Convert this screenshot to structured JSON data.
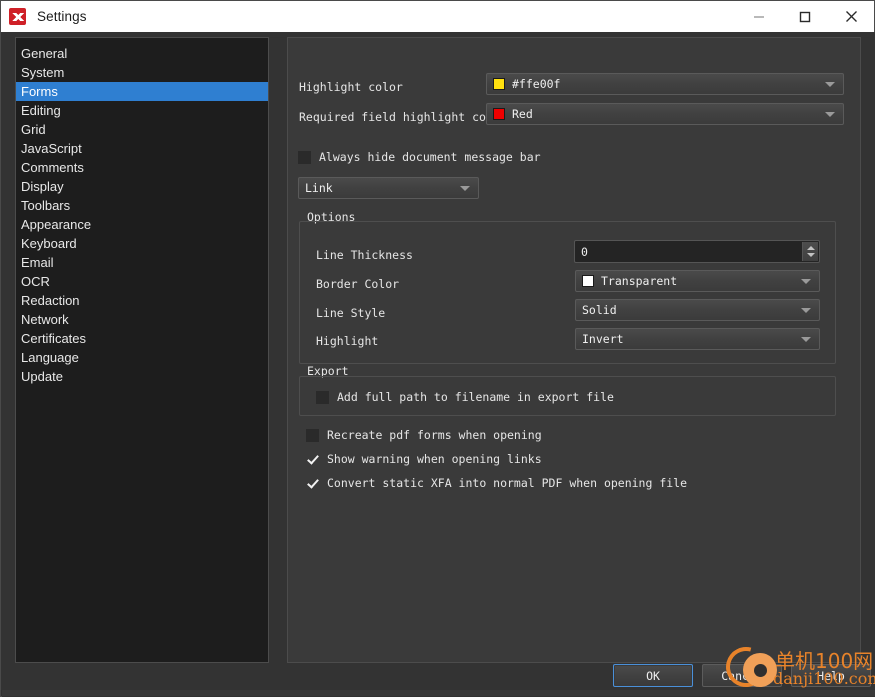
{
  "window": {
    "title": "Settings",
    "icon": "app-logo-icon",
    "controls": {
      "minimize": "minimize-icon",
      "maximize": "maximize-icon",
      "close": "close-icon"
    }
  },
  "sidebar": {
    "selected": "Forms",
    "items": [
      {
        "label": "General"
      },
      {
        "label": "System"
      },
      {
        "label": "Forms"
      },
      {
        "label": "Editing"
      },
      {
        "label": "Grid"
      },
      {
        "label": "JavaScript"
      },
      {
        "label": "Comments"
      },
      {
        "label": "Display"
      },
      {
        "label": "Toolbars"
      },
      {
        "label": "Appearance"
      },
      {
        "label": "Keyboard"
      },
      {
        "label": "Email"
      },
      {
        "label": "OCR"
      },
      {
        "label": "Redaction"
      },
      {
        "label": "Network"
      },
      {
        "label": "Certificates"
      },
      {
        "label": "Language"
      },
      {
        "label": "Update"
      }
    ]
  },
  "panel": {
    "highlight_color": {
      "label": "Highlight color",
      "value": "#ffe00f",
      "swatch": "#ffe00f"
    },
    "required_field_highlight_color": {
      "label": "Required field highlight color",
      "value": "Red",
      "swatch": "#ef0000"
    },
    "always_hide_message_bar": {
      "label": "Always hide document message bar",
      "checked": false
    },
    "field_type": {
      "value": "Link"
    },
    "options_group": {
      "title": "Options",
      "rows": [
        {
          "label": "Line Thickness",
          "value": "0",
          "control": "spinbox"
        },
        {
          "label": "Border Color",
          "value": "Transparent",
          "control": "combo",
          "swatch": "#ffffff"
        },
        {
          "label": "Line Style",
          "value": "Solid",
          "control": "combo"
        },
        {
          "label": "Highlight",
          "value": "Invert",
          "control": "combo"
        }
      ]
    },
    "export_group": {
      "title": "Export",
      "checkbox": {
        "label": "Add full path to filename in export file",
        "checked": false
      }
    },
    "bottom_checkboxes": [
      {
        "label": "Recreate pdf forms when opening",
        "checked": false
      },
      {
        "label": "Show warning when opening links",
        "checked": true
      },
      {
        "label": "Convert static XFA into normal PDF when opening file",
        "checked": true
      }
    ]
  },
  "footer": {
    "ok": "OK",
    "cancel": "Cancel",
    "help": "Help"
  },
  "watermark": {
    "cn": "单机100网",
    "en": "danji100.com"
  },
  "colors": {
    "accent": "#2f7fd1",
    "panel_bg": "#3a3a3a",
    "sidebar_bg": "#1d1d1d",
    "watermark": "#e8832a"
  }
}
